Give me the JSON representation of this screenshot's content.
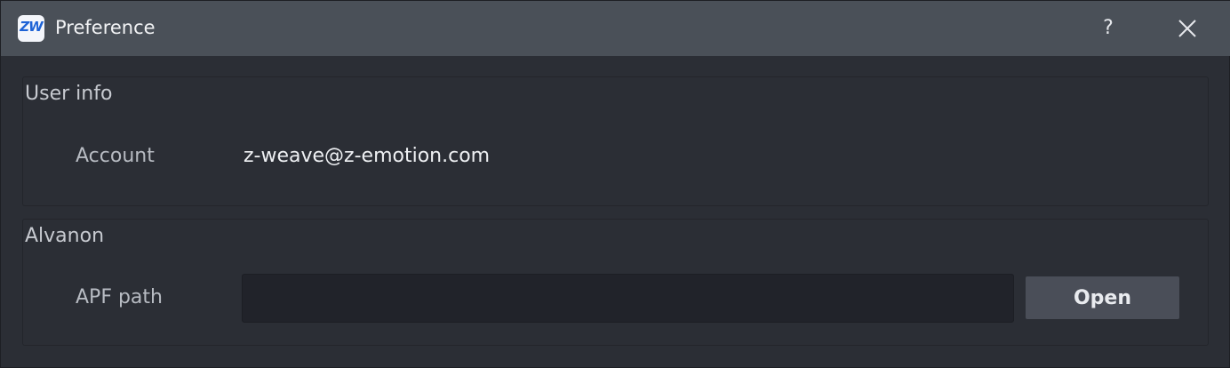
{
  "window": {
    "app_icon_text": "ZW",
    "title": "Preference",
    "help_label": "?",
    "close_icon": "close-icon"
  },
  "user_info": {
    "group_title": "User info",
    "account_label": "Account",
    "account_value": "z-weave@z-emotion.com"
  },
  "alvanon": {
    "group_title": "Alvanon",
    "apf_label": "APF path",
    "apf_value": "",
    "open_label": "Open"
  },
  "colors": {
    "titlebar": "#4a5058",
    "background": "#2b2e35",
    "button": "#4a4e58",
    "brand_icon": "#1e63d6"
  }
}
